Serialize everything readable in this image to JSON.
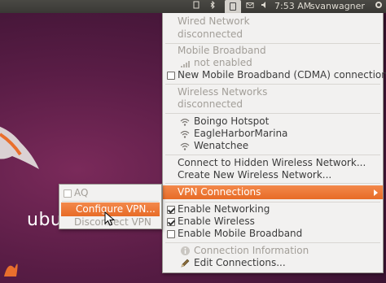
{
  "panel": {
    "time": "7:53 AM",
    "user": "svanwagner",
    "icons": [
      "indicator-icon",
      "bluetooth-icon",
      "network-icon",
      "mail-icon",
      "volume-icon",
      "gear-icon"
    ]
  },
  "desktop": {
    "brand_text": "ubu"
  },
  "network_menu": {
    "wired_header": "Wired Network",
    "wired_status": "disconnected",
    "mobile_header": "Mobile Broadband",
    "mobile_status": "not enabled",
    "new_mobile": "New Mobile Broadband (CDMA) connection...",
    "wireless_header": "Wireless Networks",
    "wireless_status": "disconnected",
    "networks": [
      "Boingo Hotspot",
      "EagleHarborMarina",
      "Wenatchee"
    ],
    "connect_hidden": "Connect to Hidden Wireless Network...",
    "create_new": "Create New Wireless Network...",
    "vpn_connections": "VPN Connections",
    "enable_networking": "Enable Networking",
    "enable_wireless": "Enable Wireless",
    "enable_mobile": "Enable Mobile Broadband",
    "connection_info": "Connection Information",
    "edit_connections": "Edit Connections...",
    "checks": {
      "networking": true,
      "wireless": true,
      "mobile": false
    }
  },
  "vpn_menu": {
    "aq": "AQ",
    "configure": "Configure VPN...",
    "disconnect": "Disconnect VPN"
  },
  "colors": {
    "highlight": "#e96f2d",
    "menu_bg": "#f2f1f0",
    "panel_bg": "#3c3b37",
    "desktop": "#5a1d46"
  }
}
